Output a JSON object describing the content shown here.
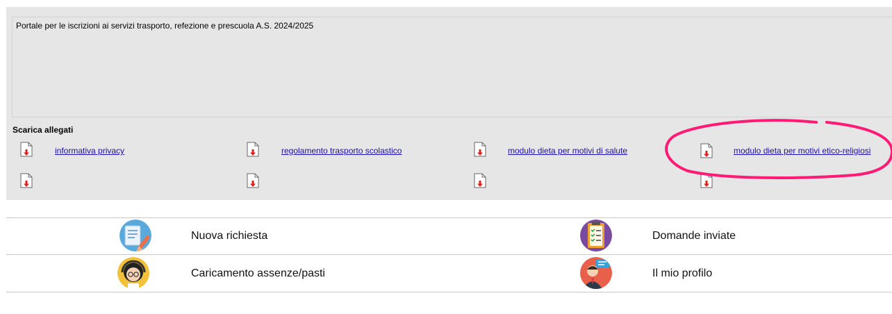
{
  "notice": {
    "text": "Portale per le iscrizioni ai servizi trasporto, refezione e prescuola A.S. 2024/2025"
  },
  "attachments": {
    "title": "Scarica allegati",
    "items": [
      {
        "label": "informativa privacy",
        "icon": "pdf-download-icon"
      },
      {
        "label": "regolamento trasporto scolastico",
        "icon": "pdf-download-icon"
      },
      {
        "label": "modulo dieta per motivi di salute",
        "icon": "pdf-download-icon"
      },
      {
        "label": "modulo dieta per motivi etico-religiosi",
        "icon": "pdf-download-icon"
      }
    ]
  },
  "menu": {
    "items": [
      {
        "label": "Nuova richiesta",
        "icon": "new-request-icon"
      },
      {
        "label": "Domande inviate",
        "icon": "checklist-icon"
      },
      {
        "label": "Caricamento assenze/pasti",
        "icon": "operator-icon"
      },
      {
        "label": "Il mio profilo",
        "icon": "profile-icon"
      }
    ]
  },
  "annotation": {
    "color": "#ff1a75",
    "icon": "highlight-ellipse"
  }
}
